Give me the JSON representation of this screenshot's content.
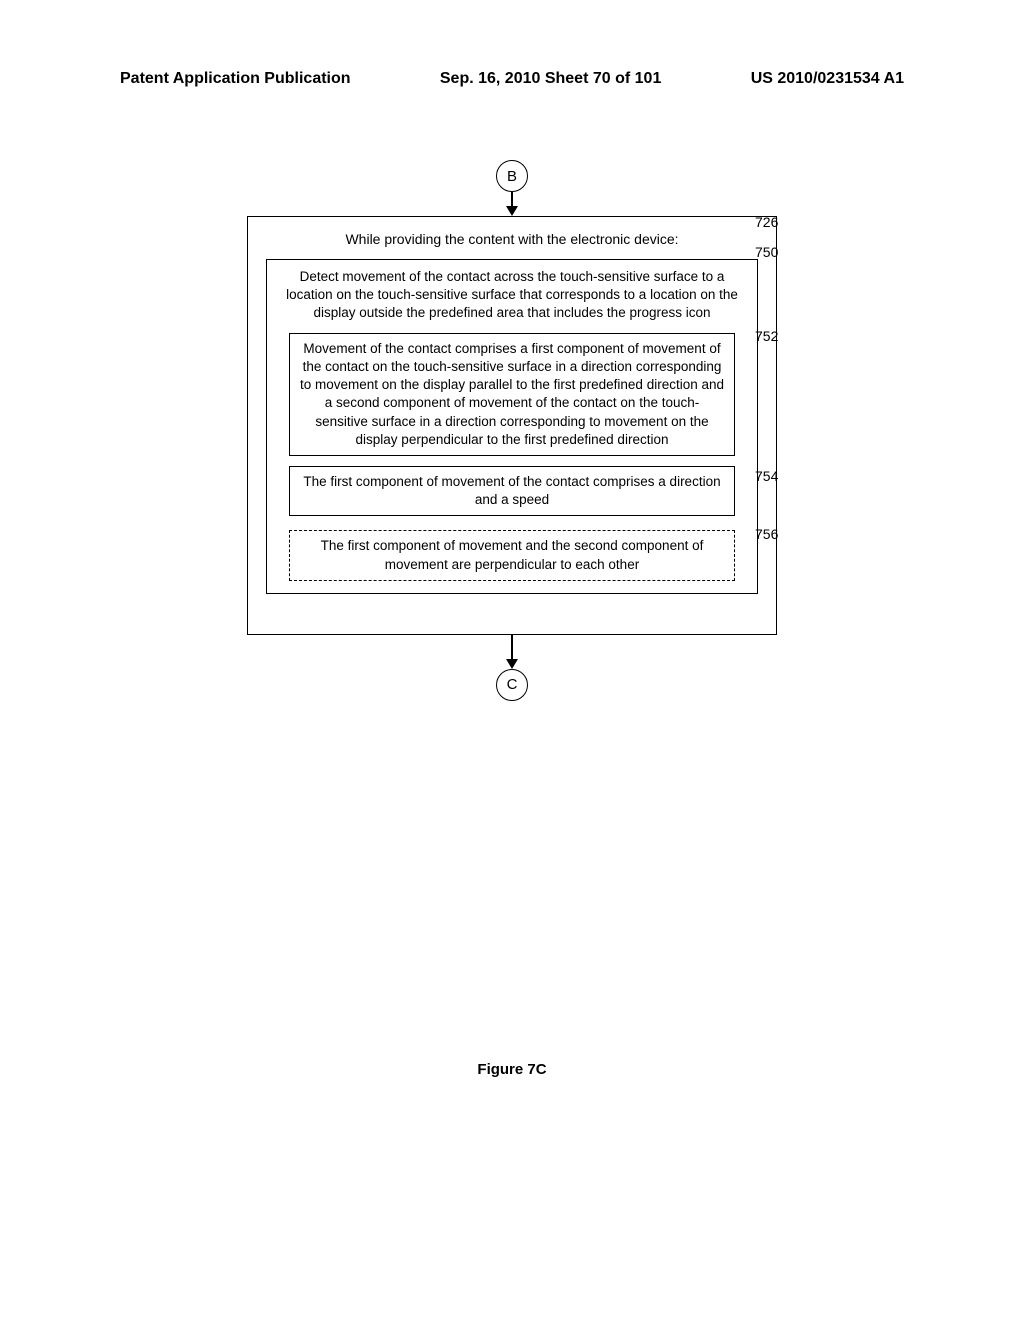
{
  "header": {
    "left": "Patent Application Publication",
    "center": "Sep. 16, 2010  Sheet 70 of 101",
    "right": "US 2010/0231534 A1"
  },
  "connectors": {
    "top": "B",
    "bottom": "C"
  },
  "boxes": {
    "outer_title": "While providing the content with the electronic device:",
    "box750": "Detect movement of the contact across the touch-sensitive surface to a location on the touch-sensitive surface that corresponds to a location on the display outside the predefined area that includes the progress icon",
    "box752": "Movement of the contact comprises a first component of movement of the contact on the touch-sensitive surface in a direction corresponding to movement on the display parallel to the first predefined direction and a second component of movement of the contact on the touch-sensitive surface in a direction corresponding to movement on the display perpendicular to the first predefined direction",
    "box754": "The first component of movement of the contact comprises a direction and a speed",
    "box756": "The first component of movement and the second component of movement are perpendicular to each other"
  },
  "refs": {
    "r726": "726",
    "r750": "750",
    "r752": "752",
    "r754": "754",
    "r756": "756"
  },
  "caption": "Figure 7C"
}
